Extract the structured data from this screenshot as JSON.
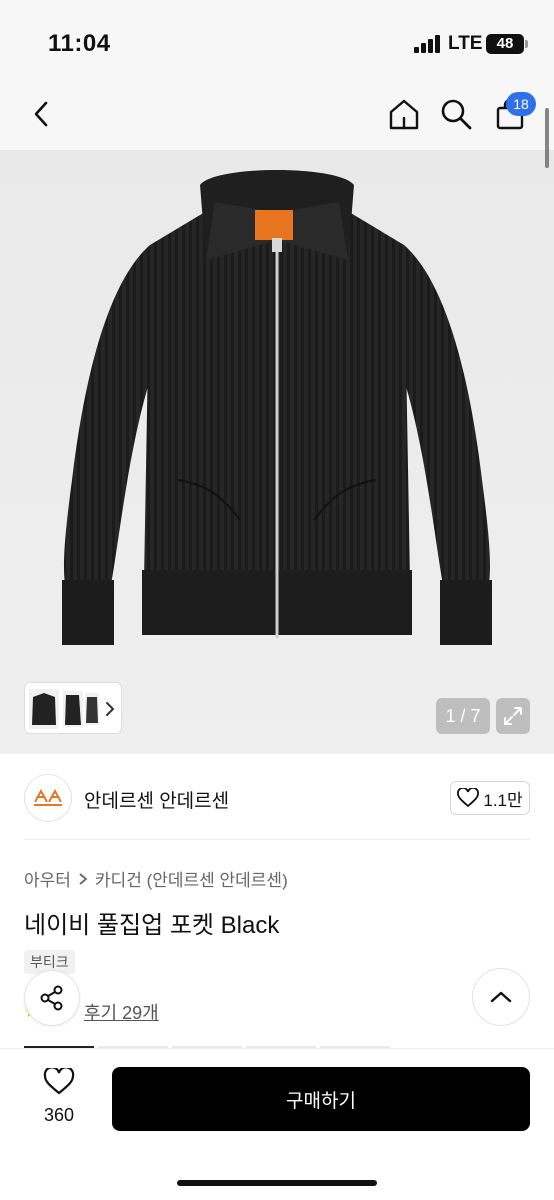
{
  "status_bar": {
    "time": "11:04",
    "network": "LTE",
    "battery": "48"
  },
  "nav": {
    "cart_count": "18",
    "icons": [
      "back-icon",
      "home-icon",
      "search-icon",
      "cart-icon"
    ]
  },
  "gallery": {
    "counter": "1 / 7"
  },
  "brand": {
    "name": "안데르센 안데르센",
    "likes": "1.1만"
  },
  "breadcrumb": {
    "level1": "아우터",
    "level2": "카디건 (안데르센 안데르센)"
  },
  "product": {
    "title": "네이비 풀집업 포켓 Black",
    "tag": "부티크",
    "reviews": "후기 29개"
  },
  "bottom_bar": {
    "wish_count": "360",
    "buy_label": "구매하기"
  },
  "colors": {
    "accent": "#2f6fe8",
    "buy_button": "#000000",
    "hero_bg": "#ececec",
    "logo_orange": "#e07a2a"
  }
}
